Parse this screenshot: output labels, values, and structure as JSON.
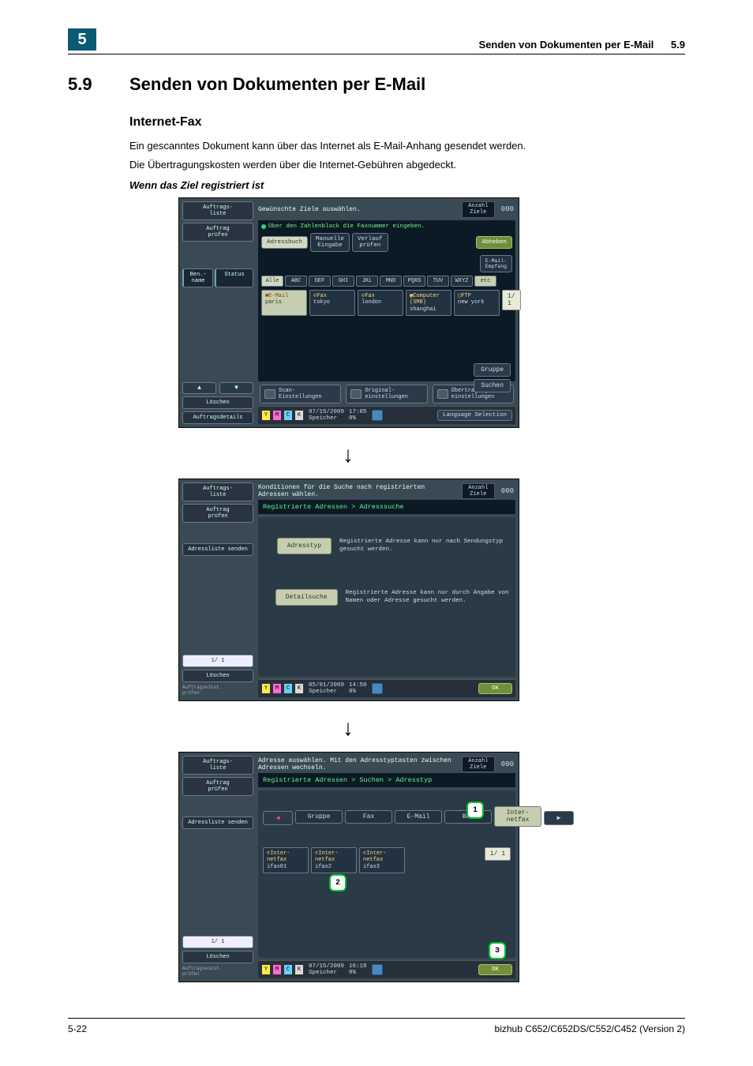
{
  "header": {
    "chapter": "5",
    "title": "Senden von Dokumenten per E-Mail",
    "secnum": "5.9"
  },
  "h1": {
    "num": "5.9",
    "title": "Senden von Dokumenten per E-Mail"
  },
  "sub": "Internet-Fax",
  "p1": "Ein gescanntes Dokument kann über das Internet als E-Mail-Anhang gesendet werden.",
  "p2": "Die Übertragungskosten werden über die Internet-Gebühren abgedeckt.",
  "em": "Wenn das Ziel registriert ist",
  "arrow_down": "↓",
  "panel1": {
    "msg": "Gewünschte Ziele auswählen.",
    "hint": "Über den Zahlenblock die Faxnummer eingeben.",
    "count_label": "Anzahl\nZiele",
    "count": "000",
    "left": {
      "jobs": "Auftrags-\nliste",
      "check": "Auftrag\nprüfen",
      "ben": "Ben.-\nname",
      "status": "Status",
      "delete": "Löschen",
      "details": "Auftragsdetails"
    },
    "tabs": {
      "adr": "Adressbuch",
      "manual": "Manuelle\nEingabe",
      "history": "Verlauf\nprüfen",
      "offhook": "Abheben",
      "email_empf": "E-Mail-\nEmpfang"
    },
    "alpha": {
      "all": "Alle",
      "abc": "ABC",
      "def": "DEF",
      "ghi": "GHI",
      "jkl": "JKL",
      "mno": "MNO",
      "pqrs": "PQRS",
      "tuv": "TUV",
      "wxyz": "WXYZ",
      "etc": "etc"
    },
    "dests": {
      "d1_lab": "E-Mail",
      "d1": "paris",
      "d2_lab": "Fax",
      "d2": "tokyo",
      "d3_lab": "Fax",
      "d3": "london",
      "d4_lab": "Computer\n(SMB)",
      "d4": "shanghai",
      "d5_lab": "FTP",
      "d5": "new york"
    },
    "page": "1/  1",
    "group": "Gruppe",
    "search": "Suchen",
    "settings": {
      "scan": "Scan-\nEinstellungen",
      "orig": "Original-\neinstellungen",
      "comm": "Übertragungs-\neinstellungen"
    },
    "status": {
      "date": "07/15/2009",
      "time": "17:05",
      "mem": "Speicher",
      "pct": "0%",
      "lang": "Language Selection"
    }
  },
  "panel2": {
    "msg": "Konditionen für die Suche nach registrierten Adressen wählen.",
    "count_label": "Anzahl\nZiele",
    "count": "000",
    "left": {
      "jobs": "Auftrags-\nliste",
      "check": "Auftrag\nprüfen",
      "send": "Adressliste senden",
      "page": "1/  1",
      "delete": "Löschen",
      "prf": "Auftragseinst.\nprüfen"
    },
    "crumb": "Registrierte Adressen > Adresssuche",
    "type_btn": "Adresstyp",
    "type_desc": "Registrierte Adresse kann nur nach Sendungstyp gesucht werden.",
    "detail_btn": "Detailsuche",
    "detail_desc": "Registrierte Adresse kann nur durch Angabe von Namen oder Adresse gesucht werden.",
    "status": {
      "date": "05/01/2009",
      "time": "14:50",
      "mem": "Speicher",
      "pct": "0%",
      "ok": "OK"
    }
  },
  "panel3": {
    "msg": "Adresse auswählen. Mit den Adresstyptasten zwischen Adressen wechseln.",
    "count_label": "Anzahl\nZiele",
    "count": "000",
    "left": {
      "jobs": "Auftrags-\nliste",
      "check": "Auftrag\nprüfen",
      "send": "Adressliste senden",
      "page": "1/  1",
      "delete": "Löschen",
      "prf": "Auftragseinst.\nprüfen"
    },
    "crumb": "Registrierte Adressen > Suchen > Adresstyp",
    "types": {
      "group": "Gruppe",
      "fax": "Fax",
      "email": "E-Mail",
      "box": "Box",
      "netfax": "Inter-\nnetfax"
    },
    "items": {
      "i1_lab": "Inter-\nnetfax",
      "i1": "ifax01",
      "i2_lab": "Inter-\nnetfax",
      "i2": "ifax2",
      "i3_lab": "Inter-\nnetfax",
      "i3": "ifax3"
    },
    "pager": "1/  1",
    "c1": "1",
    "c2": "2",
    "c3": "3",
    "status": {
      "date": "07/15/2009",
      "time": "16:18",
      "mem": "Speicher",
      "pct": "0%",
      "ok": "OK"
    }
  },
  "footer": {
    "left": "5-22",
    "right": "bizhub C652/C652DS/C552/C452 (Version 2)"
  }
}
